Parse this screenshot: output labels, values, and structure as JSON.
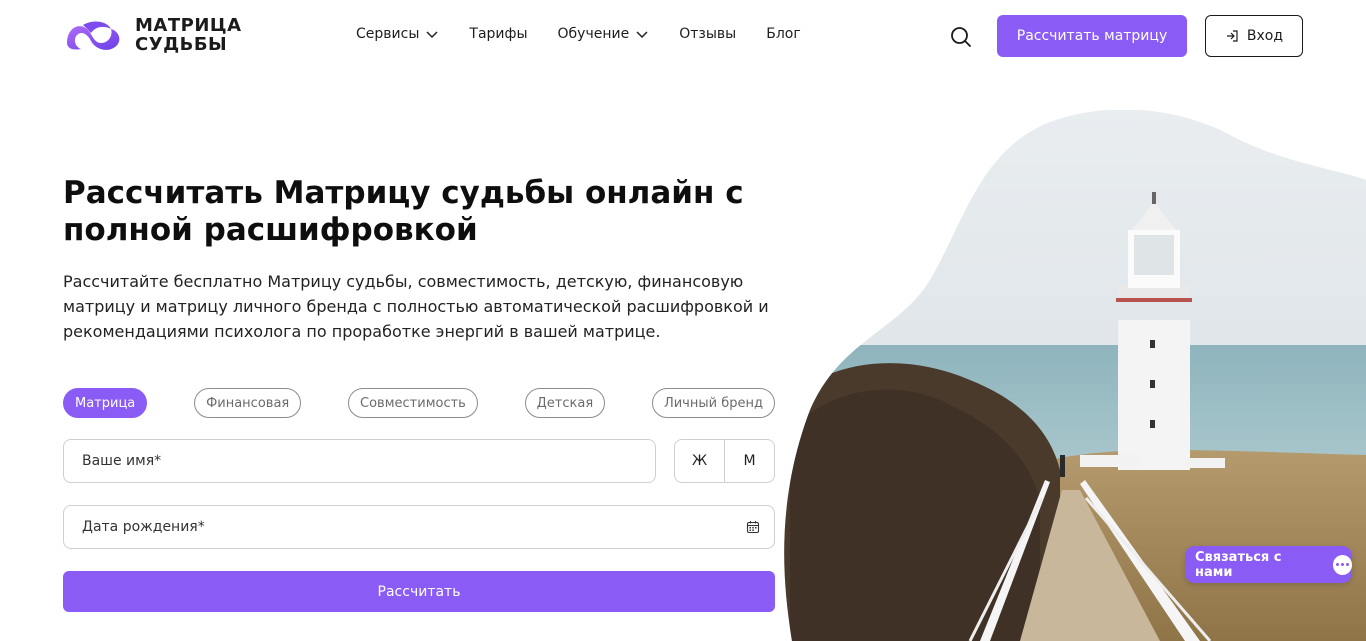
{
  "brand": {
    "line1": "МАТРИЦА",
    "line2": "СУДЬБЫ",
    "primary_color": "#8a5cf5"
  },
  "nav": {
    "items": [
      {
        "label": "Сервисы",
        "has_dropdown": true
      },
      {
        "label": "Тарифы",
        "has_dropdown": false
      },
      {
        "label": "Обучение",
        "has_dropdown": true
      },
      {
        "label": "Отзывы",
        "has_dropdown": false
      },
      {
        "label": "Блог",
        "has_dropdown": false
      }
    ],
    "search_icon": "search-icon",
    "calc_button": "Рассчитать матрицу",
    "login_button": "Вход"
  },
  "hero": {
    "title": "Рассчитать Матрицу судьбы онлайн с полной расшифровкой",
    "description": "Рассчитайте бесплатно Матрицу судьбы, совместимость, детскую, финансовую матрицу и матрицу личного бренда с полностью автоматической расшифровкой и рекомендациями психолога по проработке энергий в вашей матрице."
  },
  "tabs": [
    {
      "label": "Матрица",
      "active": true
    },
    {
      "label": "Финансовая",
      "active": false
    },
    {
      "label": "Совместимость",
      "active": false
    },
    {
      "label": "Детская",
      "active": false
    },
    {
      "label": "Личный бренд",
      "active": false
    }
  ],
  "form": {
    "name_placeholder": "Ваше имя*",
    "gender_female": "Ж",
    "gender_male": "М",
    "date_placeholder": "Дата рождения*",
    "submit": "Рассчитать"
  },
  "chat": {
    "label": "Связаться с нами"
  }
}
